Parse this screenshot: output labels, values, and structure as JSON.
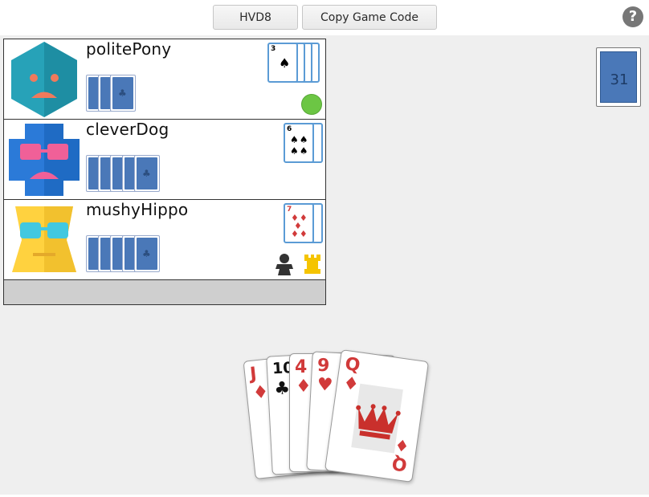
{
  "header": {
    "game_code": "HVD8",
    "copy_label": "Copy Game Code",
    "help_label": "?"
  },
  "players": [
    {
      "name": "politePony",
      "avatar_icon": "hexagon-sad-face-avatar-icon",
      "avatar_colors": {
        "main": "#27a2b8",
        "accent": "#f07a5c"
      },
      "hand_card_count": 3,
      "played_card": {
        "rank": "3",
        "suit": "♠"
      },
      "status": "green-dot-icon"
    },
    {
      "name": "cleverDog",
      "avatar_icon": "cross-glasses-avatar-icon",
      "avatar_colors": {
        "main": "#2b7ad8",
        "accent": "#f06098"
      },
      "hand_card_count": 5,
      "played_card": {
        "rank": "6",
        "suit": "♠"
      }
    },
    {
      "name": "mushyHippo",
      "avatar_icon": "yellow-sunglasses-avatar-icon",
      "avatar_colors": {
        "main": "#ffd23f",
        "accent": "#42c8e0"
      },
      "hand_card_count": 5,
      "played_card": {
        "rank": "7",
        "suit": "♦"
      },
      "badges": [
        "pawn-icon",
        "rook-icon"
      ]
    }
  ],
  "deck": {
    "count": "31"
  },
  "my_hand": [
    {
      "rank": "J",
      "suit": "♦",
      "color": "red"
    },
    {
      "rank": "10",
      "suit": "♣",
      "color": "black"
    },
    {
      "rank": "4",
      "suit": "♦",
      "color": "red"
    },
    {
      "rank": "9",
      "suit": "♥",
      "color": "red"
    },
    {
      "rank": "Q",
      "suit": "♦",
      "color": "red"
    }
  ]
}
